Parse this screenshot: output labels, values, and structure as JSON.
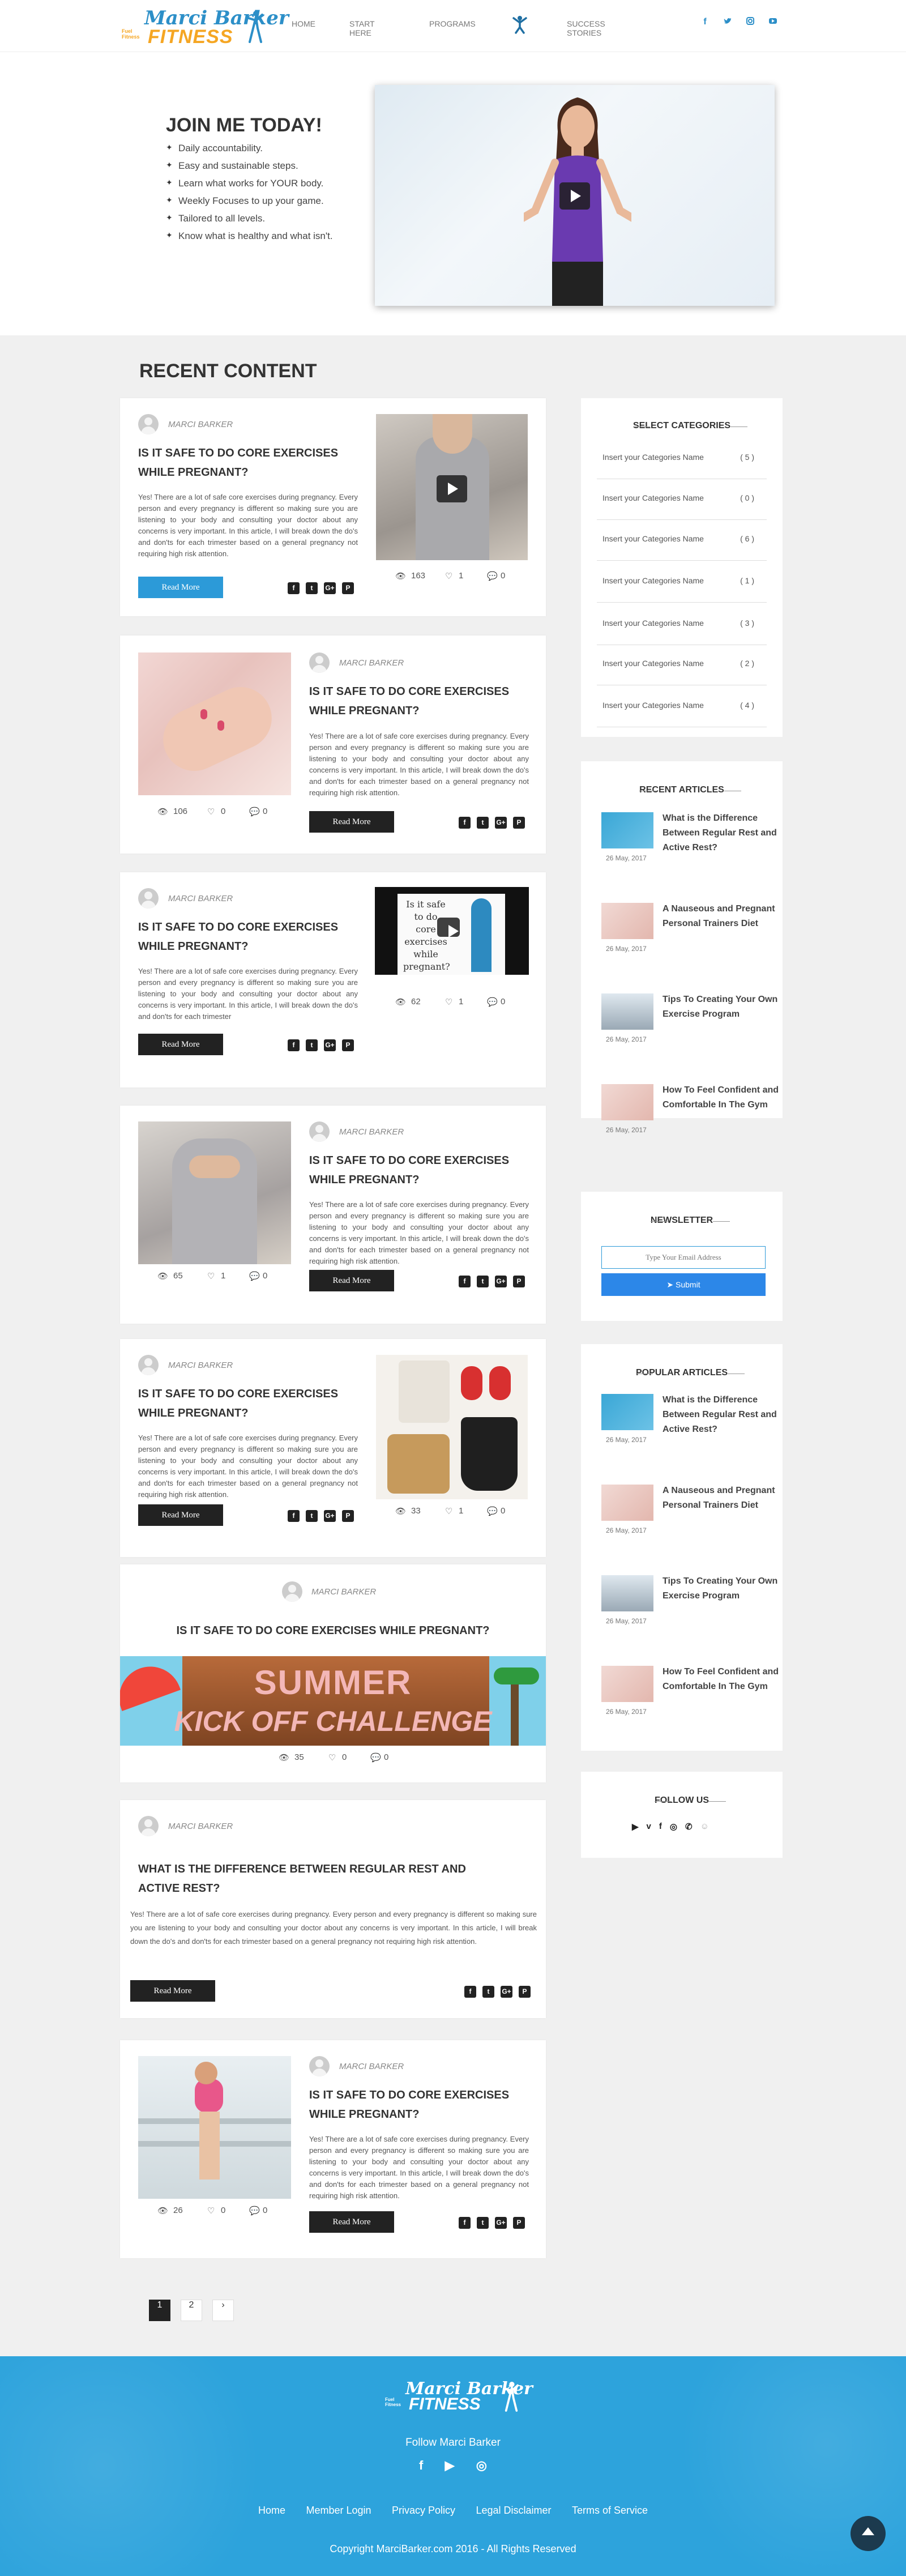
{
  "header": {
    "logo": {
      "line1": "Marci Barker",
      "tag": "Fuel Fitness",
      "line2": "FITNESS"
    },
    "nav": [
      "HOME",
      "START HERE",
      "PROGRAMS",
      "SUCCESS STORIES"
    ],
    "social_icons": [
      "facebook-icon",
      "twitter-icon",
      "instagram-icon",
      "youtube-icon"
    ]
  },
  "hero": {
    "title": "JOIN ME TODAY!",
    "bullets": [
      "Daily accountability.",
      "Easy and sustainable steps.",
      "Learn what works for YOUR body.",
      "Weekly Focuses to up your game.",
      "Tailored to all levels.",
      "Know what is healthy and what isn't."
    ]
  },
  "recent": {
    "title": "RECENT CONTENT",
    "posts": [
      {
        "author": "MARCI BARKER",
        "title": "IS IT SAFE TO DO CORE EXERCISES WHILE PREGNANT?",
        "excerpt": "Yes! There are a lot of safe core exercises during pregnancy. Every person and every pregnancy is different so making sure you are listening to your body and consulting your doctor about any concerns is very important. In this article, I will break down the do's and don'ts for each trimester based on a general pregnancy not requiring high risk attention.",
        "button": "Read More",
        "views": "163",
        "likes": "1",
        "comments": "0"
      },
      {
        "author": "MARCI BARKER",
        "title": "IS IT SAFE TO DO CORE EXERCISES WHILE PREGNANT?",
        "excerpt": "Yes! There are a lot of safe core exercises during pregnancy. Every person and every pregnancy is different so making sure you are listening to your body and consulting your doctor about any concerns is very important. In this article, I will break down the do's and don'ts for each trimester based on a general pregnancy not requiring high risk attention.",
        "button": "Read More",
        "views": "106",
        "likes": "0",
        "comments": "0"
      },
      {
        "author": "MARCI BARKER",
        "title": "IS IT SAFE TO DO CORE EXERCISES WHILE PREGNANT?",
        "excerpt": "Yes! There are a lot of safe core exercises during pregnancy. Every person and every pregnancy is different so making sure you are listening to your body and consulting your doctor about any concerns is very important. In this article, I will break down the do's and don'ts for each trimester",
        "button": "Read More",
        "views": "62",
        "likes": "1",
        "comments": "0",
        "video_text": "Is it safe to do core exercises while pregnant?"
      },
      {
        "author": "MARCI BARKER",
        "title": "IS IT SAFE TO DO CORE EXERCISES WHILE PREGNANT?",
        "excerpt": "Yes! There are a lot of safe core exercises during pregnancy. Every person and every pregnancy is different so making sure you are listening to your body and consulting your doctor about any concerns is very important. In this article, I will break down the do's and don'ts for each trimester based on a general pregnancy not requiring high risk attention.",
        "button": "Read More",
        "views": "65",
        "likes": "1",
        "comments": "0"
      },
      {
        "author": "MARCI BARKER",
        "title": "IS IT SAFE TO DO CORE EXERCISES WHILE PREGNANT?",
        "excerpt": "Yes! There are a lot of safe core exercises during pregnancy. Every person and every pregnancy is different so making sure you are listening to your body and consulting your doctor about any concerns is very important. In this article, I will break down the do's and don'ts for each trimester based on a general pregnancy not requiring high risk attention.",
        "button": "Read More",
        "views": "33",
        "likes": "1",
        "comments": "0"
      },
      {
        "author": "MARCI BARKER",
        "title": "IS IT SAFE TO DO CORE EXERCISES  WHILE PREGNANT?",
        "banner_line1": "SUMMER",
        "banner_line2": "KICK OFF CHALLENGE",
        "views": "35",
        "likes": "0",
        "comments": "0"
      },
      {
        "author": "MARCI BARKER",
        "title": "WHAT IS THE DIFFERENCE BETWEEN REGULAR REST AND ACTIVE REST?",
        "excerpt": "Yes! There are a lot of safe core exercises during pregnancy. Every person and every pregnancy is different so making sure you are listening to your body and consulting your doctor about any concerns is very important. In this article, I will break down the do's and don'ts for each trimester based on a general pregnancy not requiring high risk attention.",
        "button": "Read More"
      },
      {
        "author": "MARCI BARKER",
        "title": "IS IT SAFE TO DO CORE EXERCISES WHILE PREGNANT?",
        "excerpt": "Yes! There are a lot of safe core exercises during pregnancy. Every person and every pregnancy is different so making sure you are listening to your body and consulting your doctor about any concerns is very important. In this article, I will break down the do's and don'ts for each trimester based on a general pregnancy not requiring high risk attention.",
        "button": "Read More",
        "views": "26",
        "likes": "0",
        "comments": "0"
      }
    ],
    "share_labels": [
      "f",
      "t",
      "G+",
      "P"
    ]
  },
  "pagination": {
    "pages": [
      "1",
      "2"
    ],
    "next": "›"
  },
  "sidebar": {
    "categories": {
      "title": "SELECT CATEGORIES",
      "items": [
        {
          "name": "Insert your Categories Name",
          "count": "( 5 )"
        },
        {
          "name": "Insert your Categories Name",
          "count": "( 0 )"
        },
        {
          "name": "Insert your Categories Name",
          "count": "( 6 )"
        },
        {
          "name": "Insert your Categories Name",
          "count": "( 1 )"
        },
        {
          "name": "Insert your Categories Name",
          "count": "( 3 )"
        },
        {
          "name": "Insert your Categories Name",
          "count": "( 2 )"
        },
        {
          "name": "Insert your Categories Name",
          "count": "( 4 )"
        }
      ]
    },
    "recent_articles": {
      "title": "RECENT ARTICLES",
      "items": [
        {
          "title": "What is the Difference Between Regular Rest and Active Rest?",
          "date": "26 May, 2017"
        },
        {
          "title": "A Nauseous and Pregnant Personal Trainers Diet",
          "date": "26 May, 2017"
        },
        {
          "title": "Tips To Creating Your Own Exercise Program",
          "date": "26 May, 2017"
        },
        {
          "title": "How To Feel Confident and Comfortable In The Gym",
          "date": "26 May, 2017"
        }
      ]
    },
    "newsletter": {
      "title": "NEWSLETTER",
      "placeholder": "Type Your Email Address",
      "submit": "Submit"
    },
    "popular_articles": {
      "title": "POPULAR ARTICLES",
      "items": [
        {
          "title": "What is the Difference Between Regular Rest and Active Rest?",
          "date": "26 May, 2017"
        },
        {
          "title": "A Nauseous and Pregnant Personal Trainers Diet",
          "date": "26 May, 2017"
        },
        {
          "title": "Tips To Creating Your Own Exercise Program",
          "date": "26 May, 2017"
        },
        {
          "title": "How To Feel Confident and Comfortable In The Gym",
          "date": "26 May, 2017"
        }
      ]
    },
    "follow": {
      "title": "FOLLOW US",
      "icons": [
        "youtube-icon",
        "vimeo-icon",
        "facebook-icon",
        "instagram-icon",
        "whatsapp-icon",
        "snapchat-icon"
      ]
    }
  },
  "footer": {
    "follow": "Follow Marci Barker",
    "links": [
      "Home",
      "Member Login",
      "Privacy Policy",
      "Legal Disclaimer",
      "Terms of Service"
    ],
    "copyright": "Copyright MarciBarker.com 2016 - All Rights Reserved"
  },
  "colors": {
    "brand_blue": "#2c8fc8",
    "brand_orange": "#f5a623",
    "footer_blue": "#2da3dc",
    "button_dark": "#222222"
  }
}
